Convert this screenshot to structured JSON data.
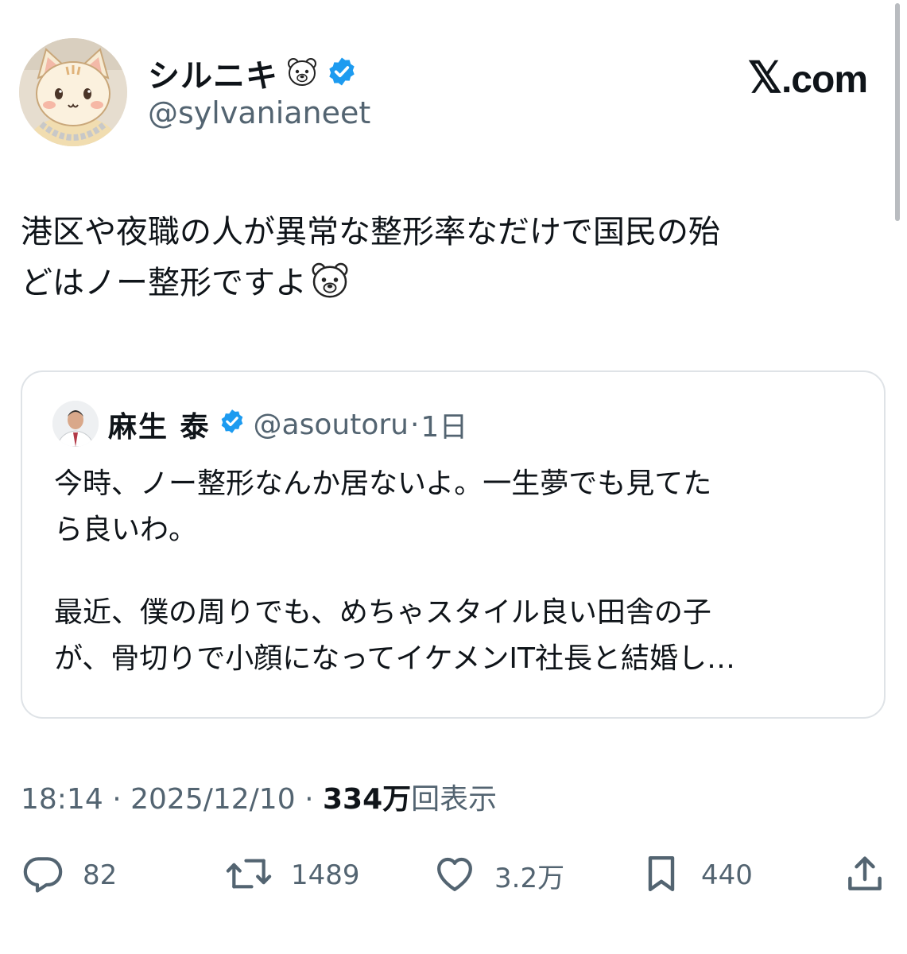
{
  "author": {
    "display_name": "シルニキ",
    "name_emoji": "🐻‍❄️",
    "verified": true,
    "handle": "@sylvanianeet"
  },
  "brand": {
    "x": "𝕏",
    "suffix": ".com"
  },
  "tweet": {
    "lines": [
      "港区や夜職の人が異常な整形率なだけで国民の殆",
      "どはノー整形ですよ"
    ],
    "end_emoji": "🐻‍❄️"
  },
  "quote": {
    "name": "麻生 泰",
    "verified": true,
    "handle": "@asoutoru",
    "separator": "·",
    "time": "1日",
    "paragraph1": [
      "今時、ノー整形なんか居ないよ。一生夢でも見てた",
      "ら良いわ。"
    ],
    "paragraph2": [
      "最近、僕の周りでも、めちゃスタイル良い田舎の子",
      "が、骨切りで小顔になってイケメンIT社長と結婚し…"
    ]
  },
  "meta": {
    "time": "18:14",
    "sep1": "·",
    "date": "2025/12/10",
    "sep2": "·",
    "views_value": "334万",
    "views_label": "回表示"
  },
  "actions": {
    "reply": {
      "icon": "reply-icon",
      "count": "82"
    },
    "retweet": {
      "icon": "retweet-icon",
      "count": "1489"
    },
    "like": {
      "icon": "heart-icon",
      "count": "3.2万"
    },
    "bookmark": {
      "icon": "bookmark-icon",
      "count": "440"
    },
    "share": {
      "icon": "share-icon"
    }
  },
  "colors": {
    "verified_blue": "#1d9bf0",
    "secondary_text": "#536471",
    "primary_text": "#0f1419",
    "card_border": "#dfe3e7"
  }
}
